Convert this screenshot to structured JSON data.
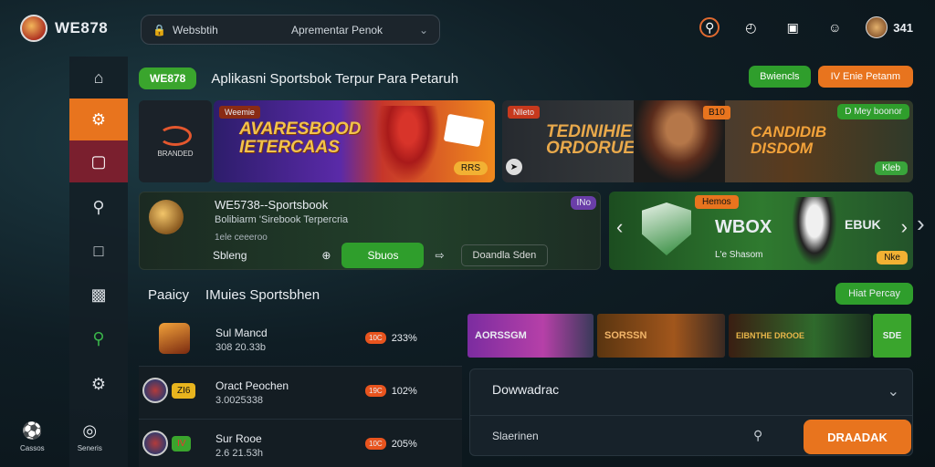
{
  "topbar": {
    "brand": "WE878",
    "search_value": "Websbtih",
    "search_placeholder": "Aprementar Penok",
    "count": "341"
  },
  "sidebar": {
    "bottom": [
      {
        "label": "Cassos",
        "icon": "soccer-ball-icon"
      },
      {
        "label": "Seneris",
        "icon": "globe-icon"
      }
    ]
  },
  "header": {
    "brand_pill": "WE878",
    "title": "Aplikasni Sportsbok Terpur Para Petaruh",
    "btn_green": "Bwiencls",
    "btn_orange": "IV Enie Petanm"
  },
  "banners": {
    "logo_text": "BRANDED",
    "b1_tag": "Weemie",
    "b1_big": "AVARESBOOD\nIETERCAAS",
    "b1_chip": "RRS",
    "b2_tag": "Nlleto",
    "b2_t1": "TEDINIHIE\nORDORUE",
    "b2_tag2": "B10",
    "b2_t2": "CANDIDIB\nDISDOM",
    "b2_tag3": "D Mey boonor",
    "b2_chip": "Kleb"
  },
  "card_left": {
    "title": "WE5738--Sportsbook",
    "subtitle": "Bolibiarm 'Sirebook Terpercria",
    "sub2": "1ele ceeeroo",
    "badge": "INo",
    "label": "Sbleng",
    "subscribe": "Sbuos",
    "download": "Doandla Sden"
  },
  "card_right": {
    "tag": "Hemos",
    "t1": "WBOX",
    "t2": "L'e Shasom",
    "t3": "EBUK",
    "chip": "Nke"
  },
  "section": {
    "title1": "Paaicy",
    "title2": "IMuies Sportsbhen",
    "btn": "Hiat Percay"
  },
  "matches": [
    {
      "name": "Sul Mancd",
      "time": "308 20.33b",
      "odds": "233%",
      "odd_tag": "10C",
      "pill": ""
    },
    {
      "name": "Oract Peochen",
      "time": "3.0025338",
      "odds": "102%",
      "odd_tag": "19C",
      "pill": "ZI6"
    },
    {
      "name": "Sur Rooe",
      "time": "2.6 21.53h",
      "odds": "205%",
      "odd_tag": "10C",
      "pill": "IV"
    }
  ],
  "promos": {
    "p1": "AORSSGM",
    "p2": "SORSSN",
    "p3": "EIBNTHE DROOE",
    "p4": "SDE"
  },
  "panel": {
    "title": "Dowwadrac",
    "input": "Slaerinen"
  },
  "cta": "DRAADAK",
  "colors": {
    "accent_orange": "#e8741e",
    "accent_green": "#2f9e2c",
    "sidebar_second": "#7a1f2e"
  }
}
